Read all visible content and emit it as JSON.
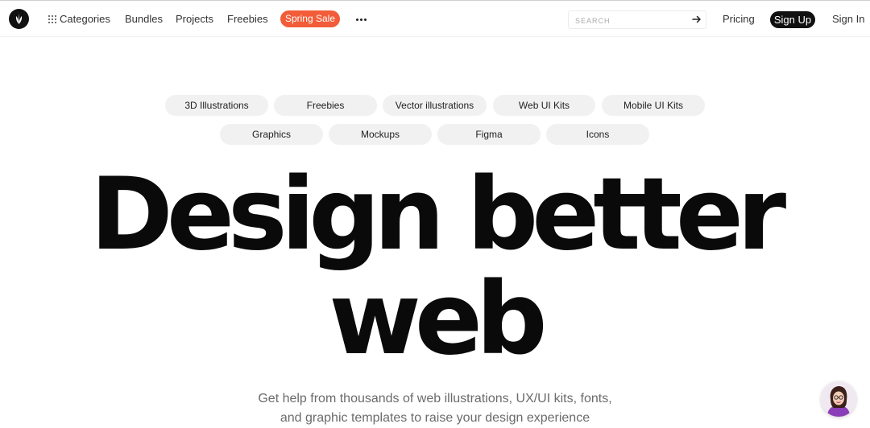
{
  "header": {
    "nav": {
      "categories": "Categories",
      "bundles": "Bundles",
      "projects": "Projects",
      "freebies": "Freebies",
      "sale": "Spring Sale"
    },
    "search": {
      "placeholder": "SEARCH"
    },
    "pricing": "Pricing",
    "signup": "Sign Up",
    "signin": "Sign In"
  },
  "chips": {
    "row1": [
      "3D Illustrations",
      "Freebies",
      "Vector illustrations",
      "Web UI Kits",
      "Mobile UI Kits"
    ],
    "row2": [
      "Graphics",
      "Mockups",
      "Figma",
      "Icons"
    ]
  },
  "hero": {
    "line1": "Design better",
    "line2": "web",
    "subtitle_line1": "Get help from thousands of web illustrations, UX/UI kits, fonts,",
    "subtitle_line2": "and graphic templates to raise your design experience"
  },
  "colors": {
    "accent": "#f25c38",
    "dark": "#111111",
    "chip_bg": "#f1f1f1"
  }
}
